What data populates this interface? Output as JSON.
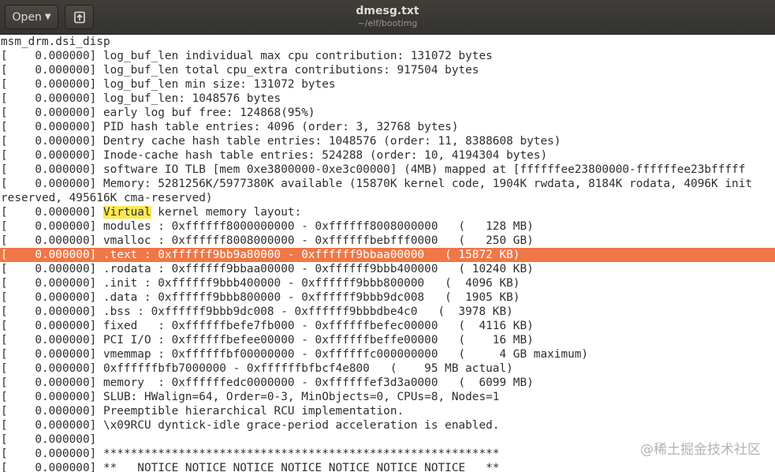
{
  "header": {
    "open_label": "Open",
    "title": "dmesg.txt",
    "subtitle": "~/elf/bootimg"
  },
  "icons": {
    "open_caret": "chevron-down-icon",
    "pin": "new-document-pin-icon"
  },
  "highlight_word": "Virtual",
  "colors": {
    "selection": "#f07746",
    "search_highlight": "#fce94f"
  },
  "lines": [
    "msm_drm.dsi_disp",
    "[    0.000000] log_buf_len individual max cpu contribution: 131072 bytes",
    "[    0.000000] log_buf_len total cpu_extra contributions: 917504 bytes",
    "[    0.000000] log_buf_len min size: 131072 bytes",
    "[    0.000000] log_buf_len: 1048576 bytes",
    "[    0.000000] early log buf free: 124868(95%)",
    "[    0.000000] PID hash table entries: 4096 (order: 3, 32768 bytes)",
    "[    0.000000] Dentry cache hash table entries: 1048576 (order: 11, 8388608 bytes)",
    "[    0.000000] Inode-cache hash table entries: 524288 (order: 10, 4194304 bytes)",
    "[    0.000000] software IO TLB [mem 0xe3800000-0xe3c00000] (4MB) mapped at [ffffffee23800000-ffffffee23bfffff",
    "[    0.000000] Memory: 5281256K/5977380K available (15870K kernel code, 1904K rwdata, 8184K rodata, 4096K init",
    "reserved, 495616K cma-reserved)",
    "[    0.000000] Virtual kernel memory layout:",
    "[    0.000000] modules : 0xffffff8000000000 - 0xffffff8008000000   (   128 MB)",
    "[    0.000000] vmalloc : 0xffffff8008000000 - 0xffffffbebfff0000   (   250 GB)",
    "[    0.000000] .text : 0xffffff9bb9a80000 - 0xffffff9bbaa00000   ( 15872 KB)",
    "[    0.000000] .rodata : 0xffffff9bbaa00000 - 0xffffff9bbb400000   ( 10240 KB)",
    "[    0.000000] .init : 0xffffff9bbb400000 - 0xffffff9bbb800000   (  4096 KB)",
    "[    0.000000] .data : 0xffffff9bbb800000 - 0xffffff9bbb9dc008   (  1905 KB)",
    "[    0.000000] .bss : 0xffffff9bbb9dc008 - 0xffffff9bbbdbe4c0   (  3978 KB)",
    "[    0.000000] fixed   : 0xffffffbefe7fb000 - 0xffffffbefec00000   (  4116 KB)",
    "[    0.000000] PCI I/O : 0xffffffbefee00000 - 0xffffffbeffe00000   (    16 MB)",
    "[    0.000000] vmemmap : 0xffffffbf00000000 - 0xffffffc000000000   (     4 GB maximum)",
    "[    0.000000] 0xffffffbfb7000000 - 0xffffffbfbcf4e800   (    95 MB actual)",
    "[    0.000000] memory  : 0xffffffedc0000000 - 0xffffffef3d3a0000   (  6099 MB)",
    "[    0.000000] SLUB: HWalign=64, Order=0-3, MinObjects=0, CPUs=8, Nodes=1",
    "[    0.000000] Preemptible hierarchical RCU implementation.",
    "[    0.000000] \\x09RCU dyntick-idle grace-period acceleration is enabled.",
    "[    0.000000]",
    "[    0.000000] **********************************************************",
    "[    0.000000] **   NOTICE NOTICE NOTICE NOTICE NOTICE NOTICE NOTICE   **"
  ],
  "selected_line_index": 15,
  "highlight_line_index": 12,
  "watermark": "@稀土掘金技术社区"
}
